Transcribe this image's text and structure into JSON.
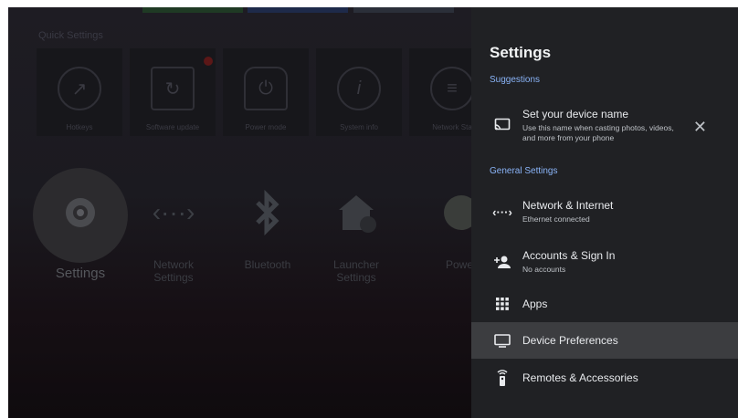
{
  "background": {
    "quick_settings_label": "Quick Settings",
    "tiles": [
      {
        "label": "Hotkeys",
        "icon": "hotkeys-icon"
      },
      {
        "label": "Software update",
        "icon": "software-update-icon"
      },
      {
        "label": "Power mode",
        "icon": "power-mode-icon"
      },
      {
        "label": "System info",
        "icon": "info-icon"
      },
      {
        "label": "Network Sta",
        "icon": "network-status-icon"
      }
    ],
    "apps": [
      {
        "label": "Settings",
        "icon": "settings-icon"
      },
      {
        "label": "Network\nSettings",
        "icon": "network-icon"
      },
      {
        "label": "Bluetooth",
        "icon": "bluetooth-icon"
      },
      {
        "label": "Launcher\nSettings",
        "icon": "launcher-settings-icon"
      },
      {
        "label": "Power",
        "icon": "power-icon"
      }
    ]
  },
  "panel": {
    "title": "Settings",
    "suggestions_header": "Suggestions",
    "suggestion": {
      "title": "Set your device name",
      "subtitle": "Use this name when casting photos, videos, and more from your phone",
      "icon": "cast-icon"
    },
    "general_header": "General Settings",
    "items": [
      {
        "title": "Network & Internet",
        "subtitle": "Ethernet connected",
        "icon": "network-icon"
      },
      {
        "title": "Accounts & Sign In",
        "subtitle": "No accounts",
        "icon": "add-account-icon"
      },
      {
        "title": "Apps",
        "subtitle": "",
        "icon": "apps-grid-icon"
      },
      {
        "title": "Device Preferences",
        "subtitle": "",
        "icon": "tv-icon"
      },
      {
        "title": "Remotes & Accessories",
        "subtitle": "",
        "icon": "remote-icon"
      }
    ],
    "accent_color": "#8ab4f8",
    "selected_item": "Device Preferences"
  }
}
